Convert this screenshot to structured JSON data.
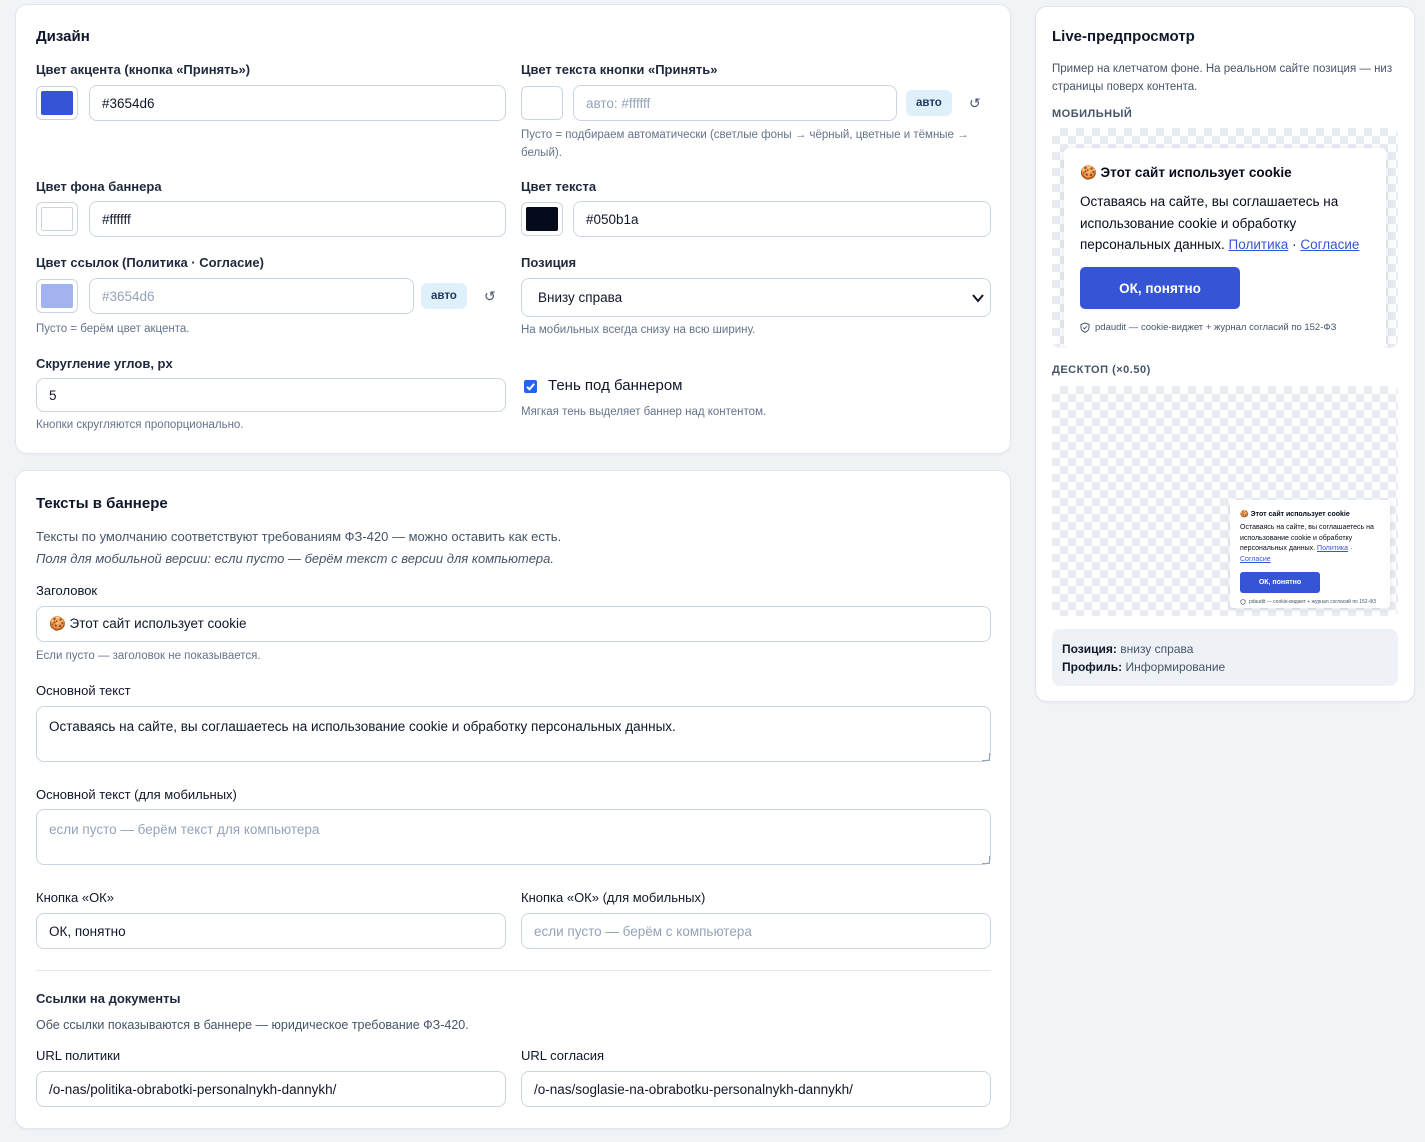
{
  "design": {
    "title": "Дизайн",
    "accent": {
      "label": "Цвет акцента (кнопка «Принять»)",
      "value": "#3654d6",
      "swatch": "#3654d6"
    },
    "btn_text": {
      "label": "Цвет текста кнопки «Принять»",
      "placeholder": "авто: #ffffff",
      "auto": "авто",
      "reset": "↺",
      "hint": "Пусто = подбираем автоматически (светлые фоны → чёрный, цветные и тёмные → белый).",
      "swatch": "#ffffff"
    },
    "bg": {
      "label": "Цвет фона баннера",
      "value": "#ffffff",
      "swatch": "#ffffff"
    },
    "text": {
      "label": "Цвет текста",
      "value": "#050b1a",
      "swatch": "#050b1a"
    },
    "links": {
      "label": "Цвет ссылок (Политика · Согласие)",
      "placeholder": "#3654d6",
      "auto": "авто",
      "reset": "↺",
      "hint": "Пусто = берём цвет акцента.",
      "swatch": "#a3b3ef"
    },
    "position": {
      "label": "Позиция",
      "value": "Внизу справа",
      "hint": "На мобильных всегда снизу на всю ширину."
    },
    "radius": {
      "label": "Скругление углов, px",
      "value": "5",
      "hint": "Кнопки скругляются пропорционально."
    },
    "shadow": {
      "label": "Тень под баннером",
      "checked": true,
      "hint": "Мягкая тень выделяет баннер над контентом."
    }
  },
  "texts": {
    "title": "Тексты в баннере",
    "intro1": "Тексты по умолчанию соответствуют требованиям ФЗ-420 — можно оставить как есть.",
    "intro2": "Поля для мобильной версии: если пусто — берём текст с версии для компьютера.",
    "heading": {
      "label": "Заголовок",
      "value": "🍪 Этот сайт использует cookie",
      "hint": "Если пусто — заголовок не показывается."
    },
    "body": {
      "label": "Основной текст",
      "value": "Оставаясь на сайте, вы соглашаетесь на использование cookie и обработку персональных данных."
    },
    "body_mobile": {
      "label": "Основной текст (для мобильных)",
      "placeholder": "если пусто — берём текст для компьютера"
    },
    "ok": {
      "label": "Кнопка «ОК»",
      "value": "ОК, понятно"
    },
    "ok_mobile": {
      "label": "Кнопка «ОК» (для мобильных)",
      "placeholder": "если пусто — берём с компьютера"
    },
    "docs_title": "Ссылки на документы",
    "docs_hint": "Обе ссылки показываются в баннере — юридическое требование ФЗ-420.",
    "policy_url": {
      "label": "URL политики",
      "value": "/o-nas/politika-obrabotki-personalnykh-dannykh/"
    },
    "consent_url": {
      "label": "URL согласия",
      "value": "/o-nas/soglasie-na-obrabotku-personalnykh-dannykh/"
    }
  },
  "preview": {
    "title": "Live-предпросмотр",
    "sub": "Пример на клетчатом фоне. На реальном сайте позиция — низ страницы поверх контента.",
    "mobile_label": "МОБИЛЬНЫЙ",
    "desktop_label": "ДЕСКТОП (×0.50)",
    "banner": {
      "title": "🍪 Этот сайт использует cookie",
      "body": "Оставаясь на сайте, вы соглашаетесь на использование cookie и обработку персональных данных.",
      "policy": "Политика",
      "sep": "·",
      "consent": "Согласие",
      "button": "ОК, понятно",
      "footer": "pdaudit — cookie-виджет + журнал согласий по 152-ФЗ"
    },
    "info": {
      "position_label": "Позиция:",
      "position_value": "внизу справа",
      "profile_label": "Профиль:",
      "profile_value": "Информирование"
    }
  },
  "colors": {
    "accent": "#3654d6",
    "text": "#050b1a",
    "link_swatch": "#a3b3ef"
  }
}
